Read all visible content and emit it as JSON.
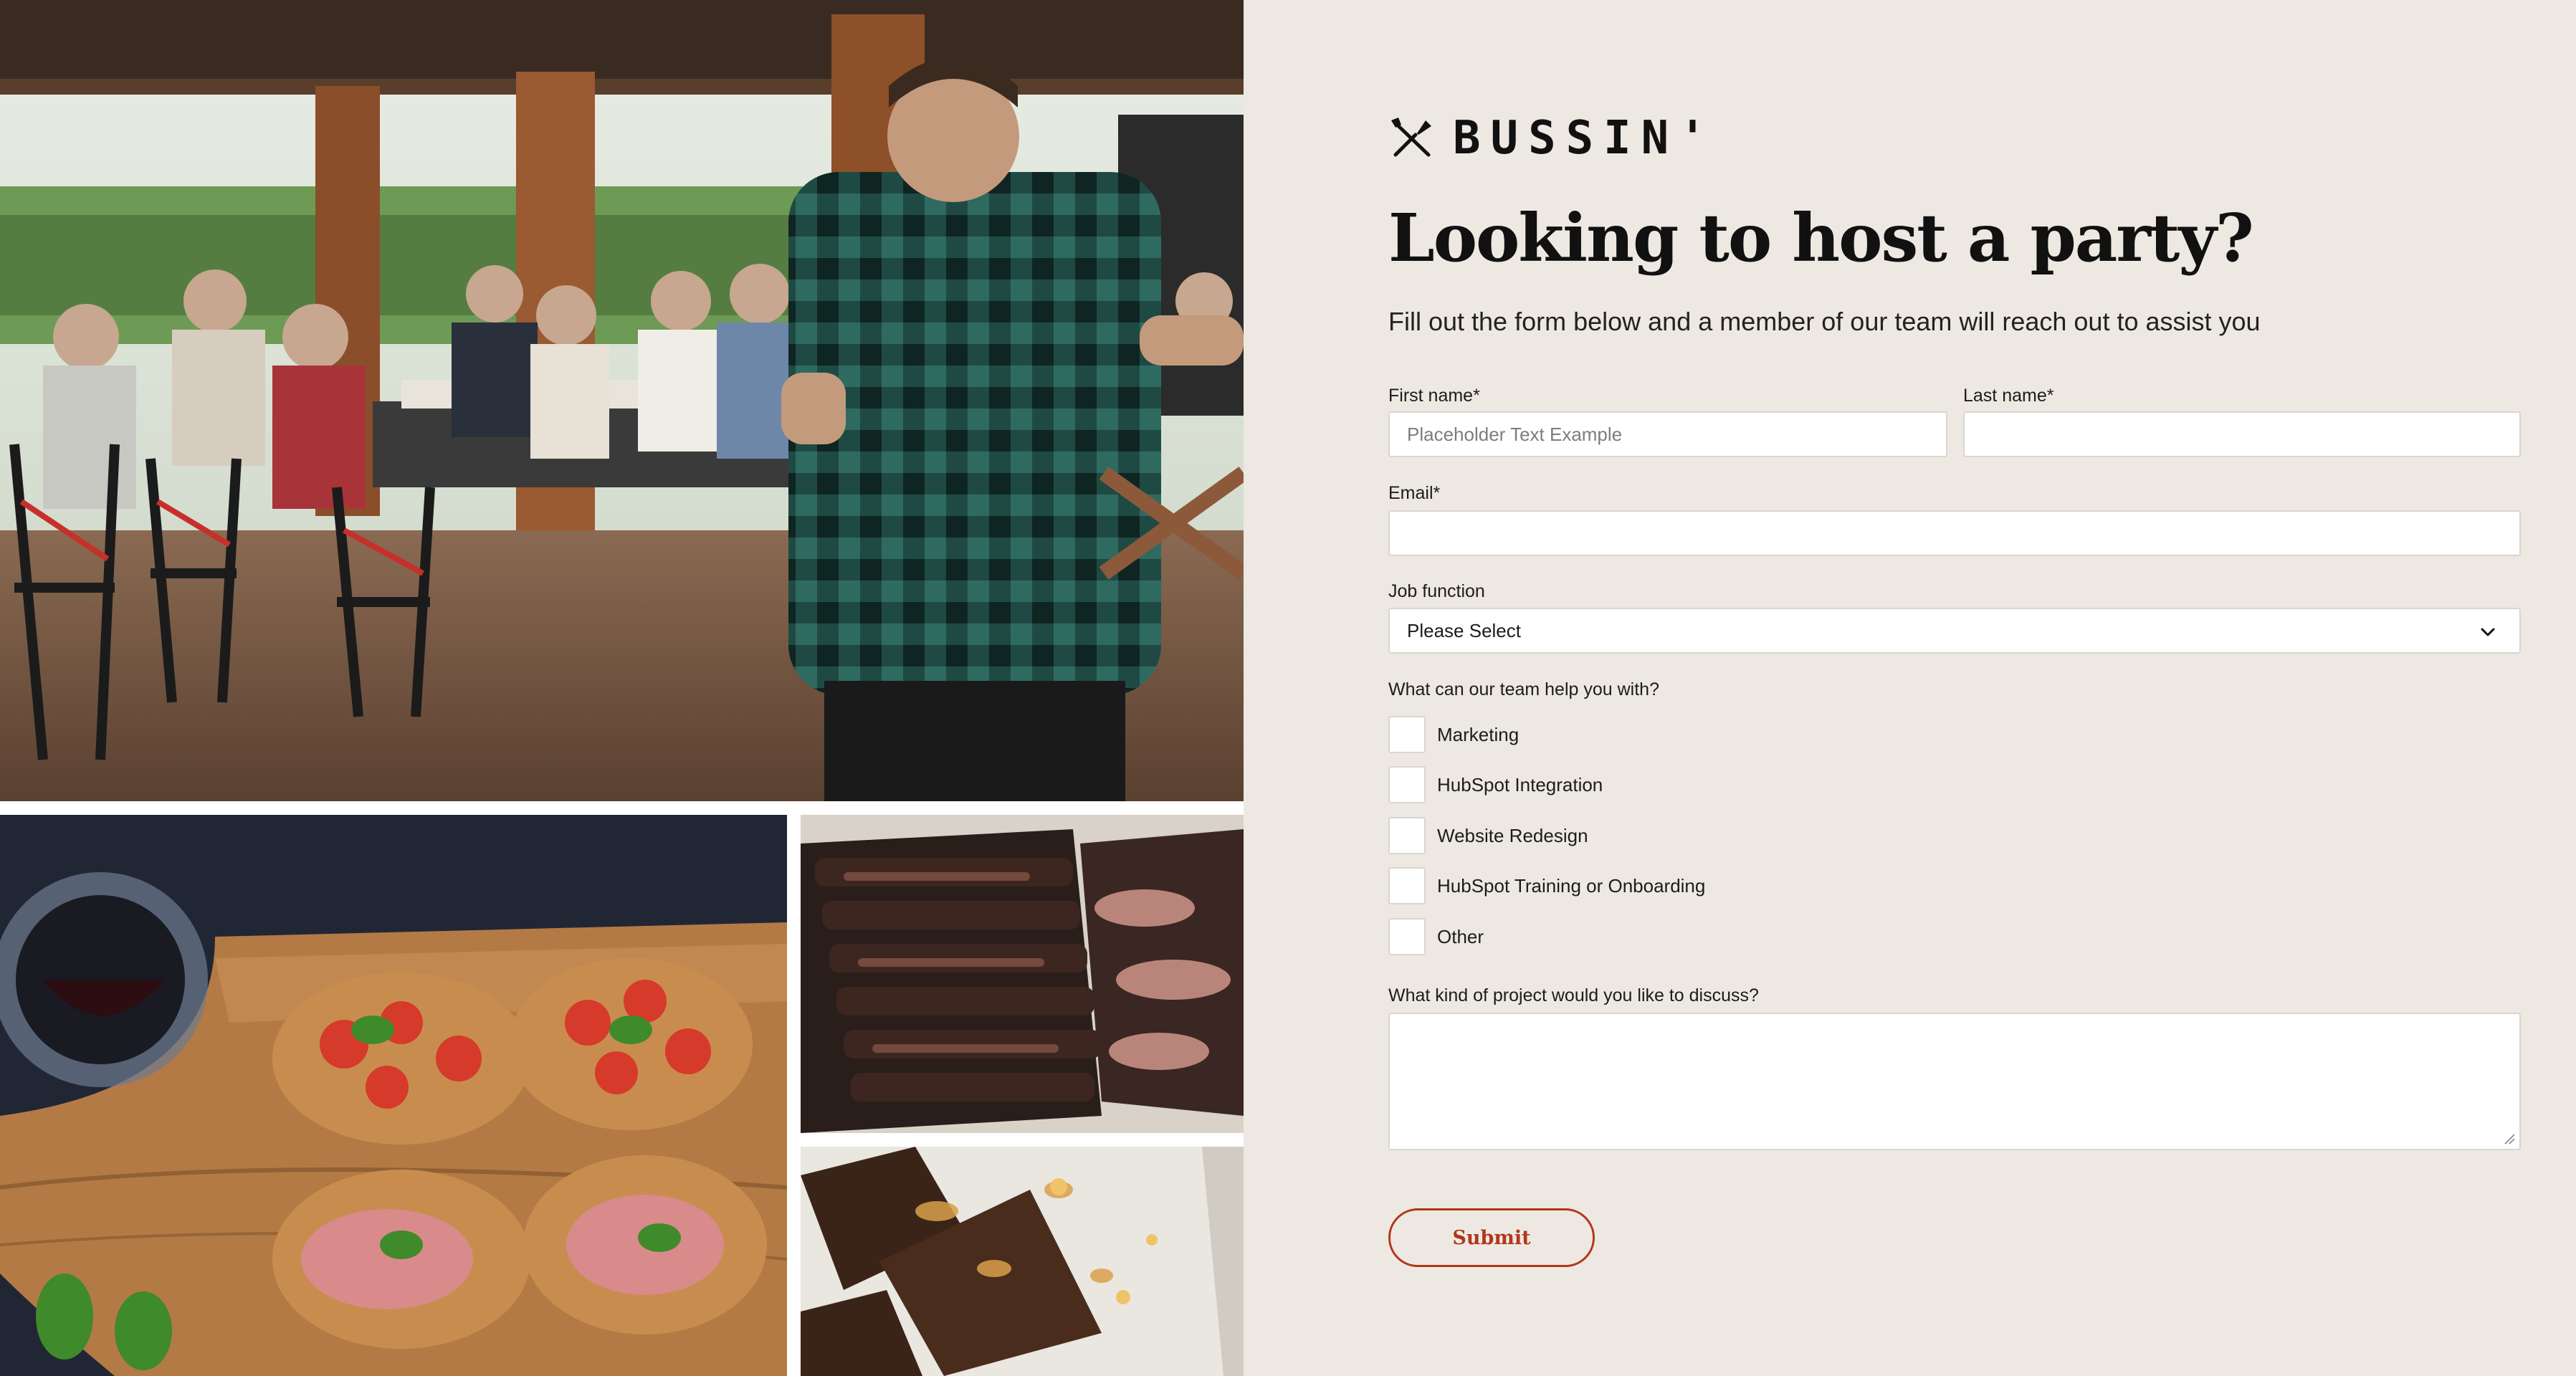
{
  "brand": {
    "name": "BUSSIN'",
    "icon": "crossed-utensils-icon"
  },
  "images": {
    "party": "party-photo",
    "bruschetta": "bruschetta-photo",
    "ribs": "ribs-photo",
    "brownie": "brownie-photo"
  },
  "form": {
    "title": "Looking to host a party?",
    "subtitle": "Fill out the form below and a member of our team will reach out to assist you",
    "first_name": {
      "label": "First name*",
      "placeholder": "Placeholder Text Example",
      "value": ""
    },
    "last_name": {
      "label": "Last name*",
      "placeholder": "",
      "value": ""
    },
    "email": {
      "label": "Email*",
      "placeholder": "",
      "value": ""
    },
    "job_function": {
      "label": "Job function",
      "selected": "Please Select"
    },
    "help": {
      "label": "What can our team help you with?",
      "options": [
        "Marketing",
        "HubSpot Integration",
        "Website Redesign",
        "HubSpot Training or Onboarding",
        "Other"
      ]
    },
    "project": {
      "label": "What kind of project would you like to discuss?",
      "value": ""
    },
    "submit_label": "Submit"
  },
  "colors": {
    "panel_bg": "#ede9e2",
    "accent": "#b3361c",
    "field_border": "#d9d5cf"
  }
}
